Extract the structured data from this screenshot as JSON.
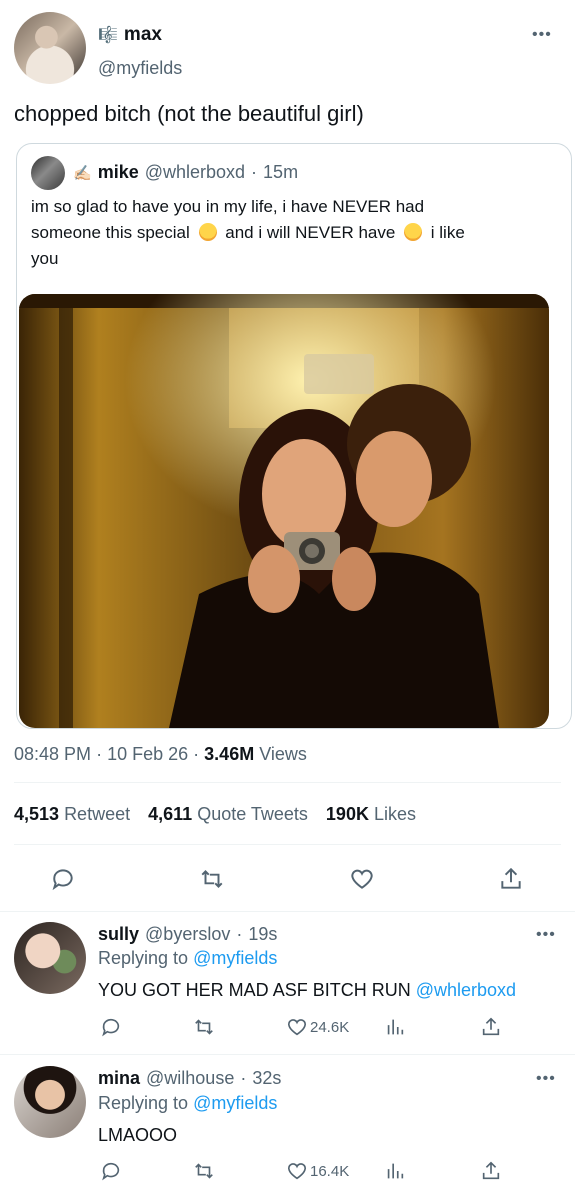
{
  "main_tweet": {
    "author_name": "max",
    "name_badge": "🎼",
    "author_handle": "@myfields",
    "text": "chopped bitch (not the beautiful girl)",
    "more_icon": "more-dots-icon",
    "quote": {
      "author_emoji": "✍🏻",
      "author_name": "mike",
      "author_handle": "@whlerboxd",
      "separator": "·",
      "time": "15m",
      "text_line1": "im so glad to have you in my life, i have NEVER had",
      "text_line2a": "someone this special",
      "text_line2b": "and i will NEVER have",
      "text_line2c": "i like",
      "text_line3": "you",
      "emoji_name": "smiling-face-with-hearts"
    },
    "time": "08:48 PM",
    "sep": "·",
    "date": "10 Feb 26",
    "views_count": "3.46M",
    "views_label": "Views",
    "retweets_count": "4,513",
    "retweets_label": "Retweet",
    "quotes_count": "4,611",
    "quotes_label": "Quote Tweets",
    "likes_count": "190K",
    "likes_label": "Likes"
  },
  "replies": [
    {
      "name": "sully",
      "handle": "@byerslov",
      "sep": "·",
      "time": "19s",
      "replying_prefix": "Replying to",
      "replying_to": "@myfields",
      "text": "YOU GOT HER MAD ASF BITCH RUN",
      "mention": "@whlerboxd",
      "likes": "24.6K"
    },
    {
      "name": "mina",
      "handle": "@wilhouse",
      "sep": "·",
      "time": "32s",
      "replying_prefix": "Replying to",
      "replying_to": "@myfields",
      "text": "LMAOOO",
      "mention": "",
      "likes": "16.4K"
    }
  ],
  "colors": {
    "accent": "#1d9bf0",
    "muted": "#536471",
    "divider": "#eff3f4"
  }
}
